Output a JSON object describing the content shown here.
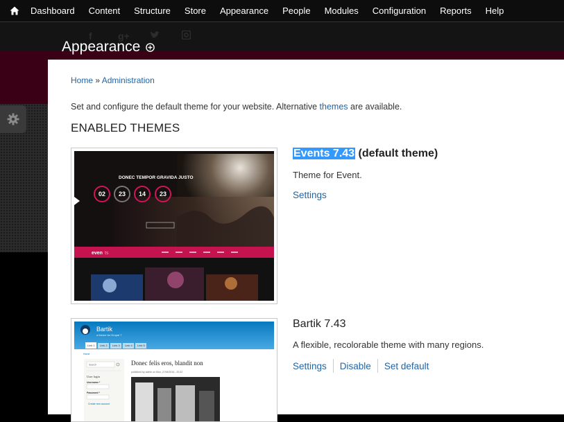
{
  "toolbar": {
    "home_icon": "home-icon",
    "items": [
      "Dashboard",
      "Content",
      "Structure",
      "Store",
      "Appearance",
      "People",
      "Modules",
      "Configuration",
      "Reports",
      "Help"
    ]
  },
  "social_icons": [
    "f",
    "g+",
    "twitter-icon",
    "instagram-icon"
  ],
  "page": {
    "title": "Appearance",
    "add_icon": "plus-circle-icon"
  },
  "breadcrumb": {
    "home": "Home",
    "separator": "»",
    "admin": "Administration"
  },
  "intro": {
    "before": "Set and configure the default theme for your website. Alternative ",
    "link": "themes",
    "after": " are available."
  },
  "section_heading": "ENABLED THEMES",
  "themes": {
    "events": {
      "name": "Events 7.43",
      "suffix": " (default theme)",
      "description": "Theme for Event.",
      "settings": "Settings",
      "preview": {
        "headline": "DONEC TEMPOR GRAVIDA JUSTO",
        "counters": [
          "02",
          "23",
          "14",
          "23"
        ],
        "logo_a": "even",
        "logo_b": "ts"
      }
    },
    "bartik": {
      "name": "Bartik 7.43",
      "description": "A flexible, recolorable theme with many regions.",
      "settings": "Settings",
      "disable": "Disable",
      "set_default": "Set default",
      "preview": {
        "site_name": "Bartik",
        "slogan": "a theme for Drupal 7",
        "tabs": [
          "Link 1",
          "Link 2",
          "Link 3",
          "Link 4",
          "Link 5"
        ],
        "home": "Home",
        "search": "Search",
        "login": "User login",
        "username": "Username *",
        "password": "Password *",
        "create": "Create new account",
        "article_title": "Donec felis eros, blandit non",
        "byline": "published by admin on Mon, 27/06/2016 - 20:32"
      }
    }
  },
  "colors": {
    "link": "#1f64a6",
    "selection": "#3399ff",
    "crimson": "#3a0016",
    "accent": "#d4145a"
  }
}
